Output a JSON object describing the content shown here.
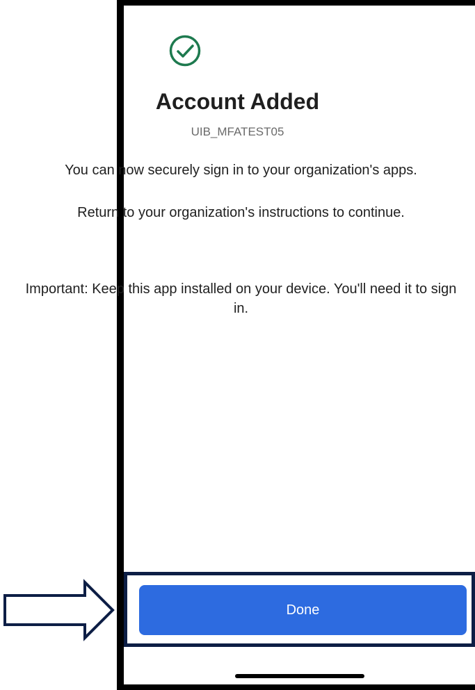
{
  "screen": {
    "title": "Account Added",
    "account_name": "UIB_MFATEST05",
    "message_1": "You can now securely sign in to your organization's apps.",
    "message_2": "Return to your organization's instructions to continue.",
    "important_label": "Important",
    "important_text": ": Keep this app installed on your device. You'll need it to sign in.",
    "done_label": "Done"
  },
  "colors": {
    "success_green": "#1e7a4f",
    "button_blue": "#2d6be0",
    "highlight_navy": "#0d1e45"
  },
  "icons": {
    "status": "check-circle-icon",
    "pointer": "arrow-right-icon"
  }
}
